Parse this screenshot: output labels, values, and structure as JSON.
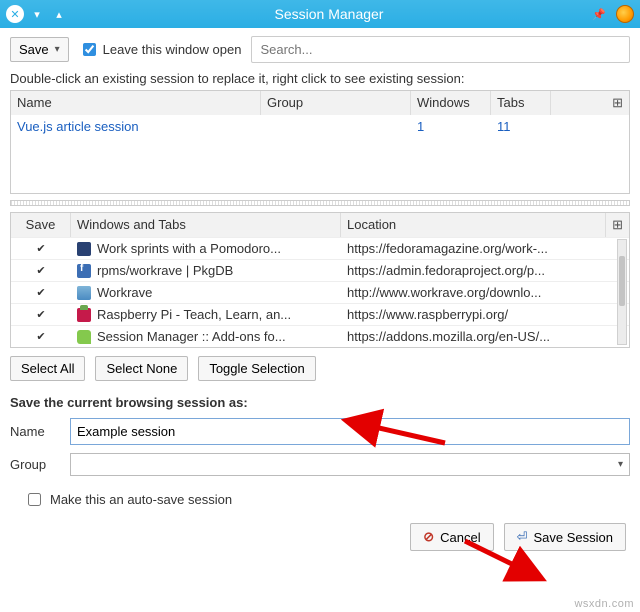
{
  "titlebar": {
    "title": "Session Manager"
  },
  "toolbar": {
    "save_label": "Save",
    "leave_open_label": "Leave this window open",
    "leave_open_checked": true,
    "search_placeholder": "Search..."
  },
  "instructions": "Double-click an existing session to replace it, right click to see existing session:",
  "sessions_table": {
    "headers": {
      "name": "Name",
      "group": "Group",
      "windows": "Windows",
      "tabs": "Tabs"
    },
    "rows": [
      {
        "name": "Vue.js article session",
        "group": "",
        "windows": "1",
        "tabs": "11"
      }
    ]
  },
  "tabs_table": {
    "headers": {
      "save": "Save",
      "wt": "Windows and Tabs",
      "loc": "Location"
    },
    "rows": [
      {
        "checked": true,
        "icon": "fav-fm",
        "icon_name": "fedoramagazine-favicon",
        "title": "Work sprints with a Pomodoro...",
        "url": "https://fedoramagazine.org/work-..."
      },
      {
        "checked": true,
        "icon": "fav-fd",
        "icon_name": "fedora-favicon",
        "title": "rpms/workrave | PkgDB",
        "url": "https://admin.fedoraproject.org/p..."
      },
      {
        "checked": true,
        "icon": "fav-wr",
        "icon_name": "workrave-favicon",
        "title": "Workrave",
        "url": "http://www.workrave.org/downlo..."
      },
      {
        "checked": true,
        "icon": "fav-rp",
        "icon_name": "raspberrypi-favicon",
        "title": "Raspberry Pi - Teach, Learn, an...",
        "url": "https://www.raspberrypi.org/"
      },
      {
        "checked": true,
        "icon": "fav-am",
        "icon_name": "addons-mozilla-favicon",
        "title": "Session Manager :: Add-ons fo...",
        "url": "https://addons.mozilla.org/en-US/..."
      }
    ]
  },
  "selection_buttons": {
    "select_all": "Select All",
    "select_none": "Select None",
    "toggle": "Toggle Selection"
  },
  "save_section": {
    "heading": "Save the current browsing session as:",
    "name_label": "Name",
    "name_value": "Example session",
    "group_label": "Group",
    "group_value": "",
    "autosave_label": "Make this an auto-save session",
    "autosave_checked": false
  },
  "footer": {
    "cancel": "Cancel",
    "save_session": "Save Session"
  },
  "watermark": "wsxdn.com"
}
